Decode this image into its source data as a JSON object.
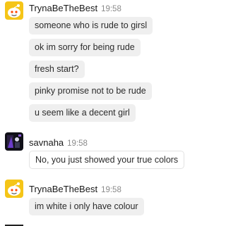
{
  "colors": {
    "bubble_bg": "#efefef",
    "username": "#1a1a1a",
    "timestamp": "#8a8a8a",
    "reddit_yellow": "#f5c518",
    "dark_avatar": "#101018",
    "purple_accent": "#6a3cc8"
  },
  "messages": [
    {
      "user": "TrynaBeTheBest",
      "time": "19:58",
      "avatar_icon": "snoo-yellow-avatar-icon",
      "lines": [
        "someone who is rude to girsl",
        "ok im sorry for being rude",
        "fresh start?",
        "pinky promise not to be rude",
        "u seem like a decent girl"
      ]
    },
    {
      "user": "savnaha",
      "time": "19:58",
      "avatar_icon": "dark-character-avatar-icon",
      "lines": [
        "No, you just showed your true colors"
      ]
    },
    {
      "user": "TrynaBeTheBest",
      "time": "19:58",
      "avatar_icon": "snoo-yellow-avatar-icon",
      "lines": [
        "im white i only have colour"
      ]
    }
  ]
}
